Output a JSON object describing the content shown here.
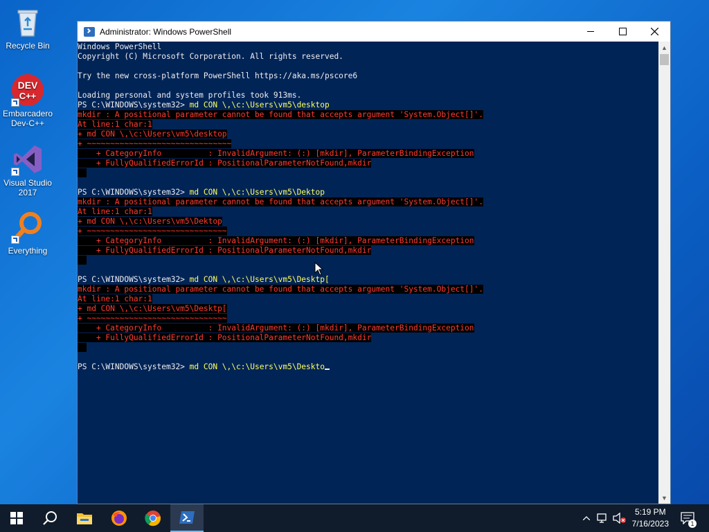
{
  "desktop": {
    "icons": [
      {
        "label": "Recycle Bin"
      },
      {
        "label": "Embarcadero Dev-C++"
      },
      {
        "label": "Visual Studio 2017"
      },
      {
        "label": "Everything"
      }
    ]
  },
  "window": {
    "title": "Administrator: Windows PowerShell",
    "console": {
      "header": [
        "Windows PowerShell",
        "Copyright (C) Microsoft Corporation. All rights reserved.",
        "",
        "Try the new cross-platform PowerShell https://aka.ms/pscore6",
        "",
        "Loading personal and system profiles took 913ms."
      ],
      "prompt": "PS C:\\WINDOWS\\system32> ",
      "blocks": [
        {
          "command": "md CON \\,\\c:\\Users\\vm5\\desktop",
          "errors": [
            "mkdir : A positional parameter cannot be found that accepts argument 'System.Object[]'.",
            "At line:1 char:1",
            "+ md CON \\,\\c:\\Users\\vm5\\desktop",
            "+ ~~~~~~~~~~~~~~~~~~~~~~~~~~~~~~~",
            "    + CategoryInfo          : InvalidArgument: (:) [mkdir], ParameterBindingException",
            "    + FullyQualifiedErrorId : PositionalParameterNotFound,mkdir"
          ]
        },
        {
          "command": "md CON \\,\\c:\\Users\\vm5\\Dektop",
          "errors": [
            "mkdir : A positional parameter cannot be found that accepts argument 'System.Object[]'.",
            "At line:1 char:1",
            "+ md CON \\,\\c:\\Users\\vm5\\Dektop",
            "+ ~~~~~~~~~~~~~~~~~~~~~~~~~~~~~~",
            "    + CategoryInfo          : InvalidArgument: (:) [mkdir], ParameterBindingException",
            "    + FullyQualifiedErrorId : PositionalParameterNotFound,mkdir"
          ]
        },
        {
          "command": "md CON \\,\\c:\\Users\\vm5\\Desktp[",
          "errors": [
            "mkdir : A positional parameter cannot be found that accepts argument 'System.Object[]'.",
            "At line:1 char:1",
            "+ md CON \\,\\c:\\Users\\vm5\\Desktp[",
            "+ ~~~~~~~~~~~~~~~~~~~~~~~~~~~~~~",
            "    + CategoryInfo          : InvalidArgument: (:) [mkdir], ParameterBindingException",
            "    + FullyQualifiedErrorId : PositionalParameterNotFound,mkdir"
          ]
        }
      ],
      "current_input": "md CON \\,\\c:\\Users\\vm5\\Deskto"
    }
  },
  "taskbar": {
    "clock_time": "5:19 PM",
    "clock_date": "7/16/2023",
    "notification_count": "1",
    "icons": [
      "windows-start-icon",
      "search-icon",
      "file-explorer-icon",
      "firefox-icon",
      "chrome-icon",
      "powershell-icon"
    ]
  },
  "colors": {
    "console_bg": "#012456",
    "error_fg": "#ff3b30",
    "command_fg": "#ffff60"
  }
}
